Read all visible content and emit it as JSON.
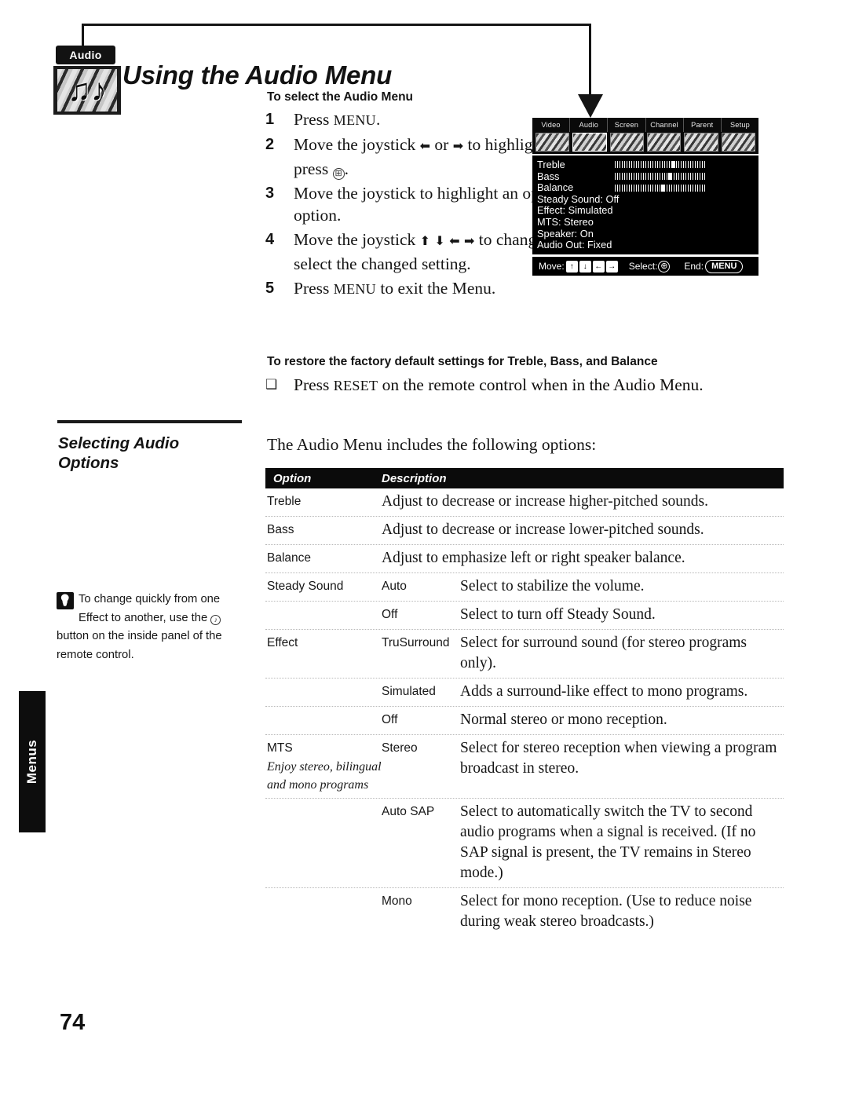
{
  "page": {
    "number": "74",
    "side_tab_label": "Menus",
    "title": "Using the Audio Menu",
    "badge_label": "Audio",
    "badge_icon": "music-notes-icon"
  },
  "procedure": {
    "heading": "To select the Audio Menu",
    "steps": [
      {
        "num": "1",
        "text": "Press MENU."
      },
      {
        "num": "2",
        "text": "Move the joystick ← or → to highlight the Audio icon and press ⊕."
      },
      {
        "num": "3",
        "text": "Move the joystick to highlight an option. Press ⊕ to select an option."
      },
      {
        "num": "4",
        "text": "Move the joystick ↑ ↓ ← → to change settings. Press ⊕ to select the changed setting."
      },
      {
        "num": "5",
        "text": "Press MENU to exit the Menu."
      }
    ]
  },
  "reset": {
    "heading": "To restore the factory default settings for Treble, Bass, and Balance",
    "bullet": "❑",
    "text": "Press RESET on the remote control when in the Audio Menu."
  },
  "side": {
    "section_heading": "Selecting Audio\nOptions",
    "tip_icon": "lightbulb-tip-icon",
    "tip_text_before": "To change quickly from one Effect to another, use the",
    "tip_glyph": "♪",
    "tip_text_after": "button on the inside panel of the remote control."
  },
  "intro": "The Audio Menu includes the following options:",
  "osd": {
    "tabs": [
      "Video",
      "Audio",
      "Screen",
      "Channel",
      "Parent",
      "Setup"
    ],
    "selected_tab": "Audio",
    "rows": [
      {
        "label": "Treble",
        "type": "slider",
        "position": 62
      },
      {
        "label": "Bass",
        "type": "slider",
        "position": 58
      },
      {
        "label": "Balance",
        "type": "slider",
        "position": 50
      },
      {
        "label": "Steady Sound: Off",
        "type": "text"
      },
      {
        "label": "Effect: Simulated",
        "type": "text"
      },
      {
        "label": "MTS: Stereo",
        "type": "text"
      },
      {
        "label": "Speaker: On",
        "type": "text"
      },
      {
        "label": "Audio Out: Fixed",
        "type": "text"
      }
    ],
    "footer": {
      "move_label": "Move:",
      "keys": [
        "↑",
        "↓",
        "←",
        "→"
      ],
      "select_label": "Select:",
      "select_glyph": "⊕",
      "end_label": "End:",
      "end_button": "MENU"
    }
  },
  "table": {
    "headers": {
      "option": "Option",
      "description": "Description"
    },
    "rows": [
      {
        "option": "Treble",
        "option_sub": "",
        "value": "",
        "desc": "Adjust to decrease or increase higher-pitched sounds."
      },
      {
        "option": "Bass",
        "option_sub": "",
        "value": "",
        "desc": "Adjust to decrease or increase lower-pitched sounds."
      },
      {
        "option": "Balance",
        "option_sub": "",
        "value": "",
        "desc": "Adjust to emphasize left or right speaker balance."
      },
      {
        "option": "Steady Sound",
        "option_sub": "",
        "value": "Auto",
        "desc": "Select to stabilize the volume."
      },
      {
        "option": "",
        "option_sub": "",
        "value": "Off",
        "desc": "Select to turn off Steady Sound."
      },
      {
        "option": "Effect",
        "option_sub": "",
        "value": "TruSurround",
        "desc": "Select for surround sound (for stereo programs only)."
      },
      {
        "option": "",
        "option_sub": "",
        "value": "Simulated",
        "desc": "Adds a surround-like effect to mono programs."
      },
      {
        "option": "",
        "option_sub": "",
        "value": "Off",
        "desc": "Normal stereo or mono reception."
      },
      {
        "option": "MTS",
        "option_sub": "Enjoy stereo, bilingual and mono programs",
        "value": "Stereo",
        "desc": "Select for stereo reception when viewing a program broadcast in stereo."
      },
      {
        "option": "",
        "option_sub": "",
        "value": "Auto SAP",
        "desc": "Select to automatically switch the TV to second audio programs when a signal is received. (If no SAP signal is present, the TV remains in Stereo mode.)"
      },
      {
        "option": "",
        "option_sub": "",
        "value": "Mono",
        "desc": "Select for mono reception. (Use to reduce noise during weak stereo broadcasts.)"
      }
    ]
  }
}
